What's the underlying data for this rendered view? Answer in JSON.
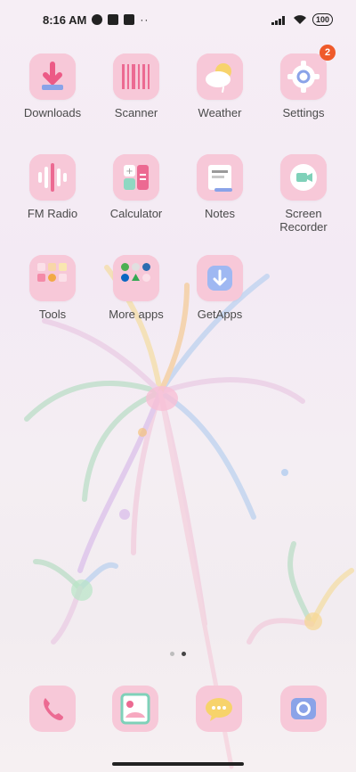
{
  "status_bar": {
    "time": "8:16 AM",
    "battery": "100",
    "icons": [
      "signal-icon",
      "wifi-icon",
      "battery-icon"
    ]
  },
  "apps": [
    {
      "label": "Downloads",
      "icon": "download-icon"
    },
    {
      "label": "Scanner",
      "icon": "barcode-icon"
    },
    {
      "label": "Weather",
      "icon": "cloud-sun-icon"
    },
    {
      "label": "Settings",
      "icon": "gear-icon",
      "badge": "2"
    },
    {
      "label": "FM Radio",
      "icon": "radio-wave-icon"
    },
    {
      "label": "Calculator",
      "icon": "calculator-icon"
    },
    {
      "label": "Notes",
      "icon": "note-icon"
    },
    {
      "label": "Screen\nRecorder",
      "icon": "video-camera-icon"
    },
    {
      "label": "Tools",
      "icon": "folder-icon"
    },
    {
      "label": "More apps",
      "icon": "folder-icon"
    },
    {
      "label": "GetApps",
      "icon": "download-arrow-icon"
    }
  ],
  "page_indicator": {
    "count": 2,
    "active": 1
  },
  "dock": [
    {
      "icon": "phone-icon"
    },
    {
      "icon": "contacts-icon"
    },
    {
      "icon": "messages-icon"
    },
    {
      "icon": "camera-icon"
    }
  ],
  "colors": {
    "tile": "#f7c8d8",
    "badge": "#ef5a2a"
  }
}
